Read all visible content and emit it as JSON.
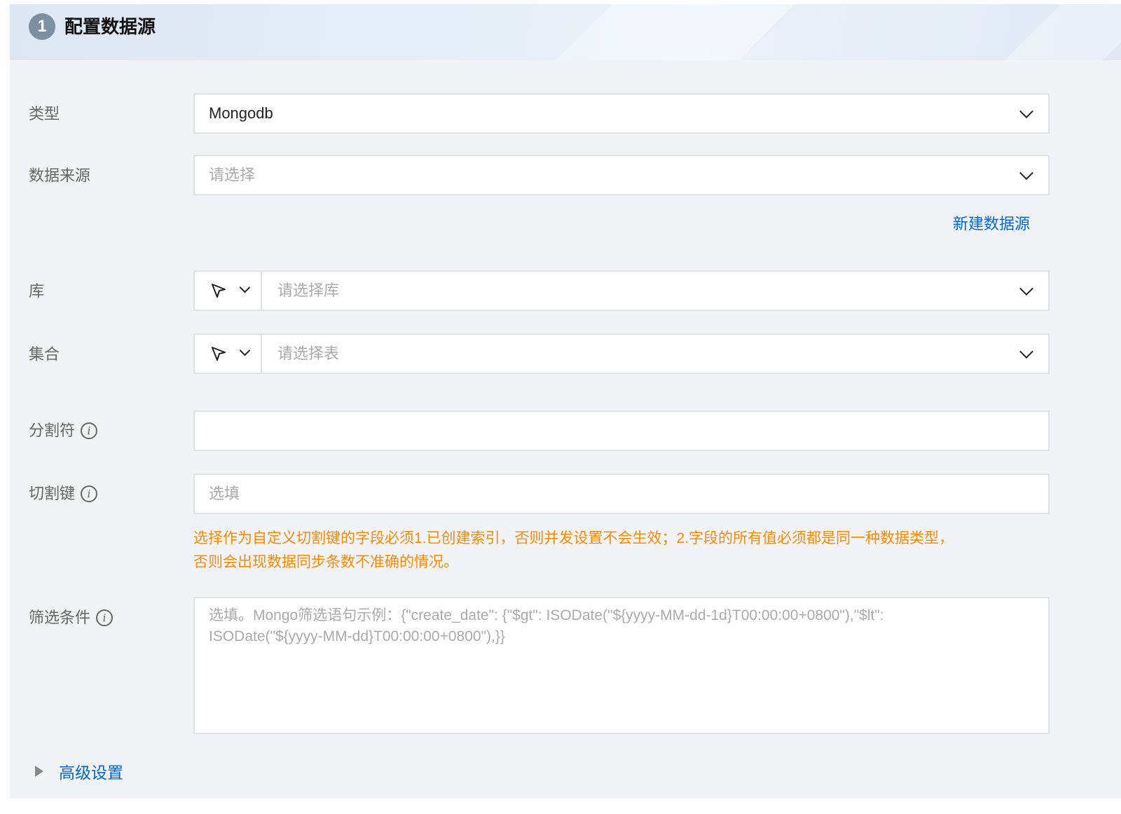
{
  "header": {
    "step": "1",
    "title": "配置数据源"
  },
  "type_field": {
    "label": "类型",
    "value": "Mongodb"
  },
  "source_field": {
    "label": "数据来源",
    "placeholder": "请选择"
  },
  "new_source_link": "新建数据源",
  "db_field": {
    "label": "库",
    "placeholder": "请选择库"
  },
  "collection_field": {
    "label": "集合",
    "placeholder": "请选择表"
  },
  "delimiter_field": {
    "label": "分割符",
    "value": ""
  },
  "split_key_field": {
    "label": "切割键",
    "placeholder": "选填"
  },
  "split_key_warning": {
    "line1": "选择作为自定义切割键的字段必须1.已创建索引，否则并发设置不会生效；2.字段的所有值必须都是同一种数据类型，",
    "line2": "否则会出现数据同步条数不准确的情况。"
  },
  "filter_field": {
    "label": "筛选条件",
    "placeholder_line1": "选填。Mongo筛选语句示例：{\"create_date\": {\"$gt\": ISODate(\"${yyyy-MM-dd-1d}T00:00:00+0800\"),\"$lt\":",
    "placeholder_line2": "ISODate(\"${yyyy-MM-dd}T00:00:00+0800\"),}}"
  },
  "advanced_settings": {
    "label": "高级设置"
  },
  "icons": {
    "info": "info-icon",
    "chevron": "chevron-down-icon",
    "cursor": "cursor-pointer-icon",
    "expand": "triangle-right-icon"
  }
}
